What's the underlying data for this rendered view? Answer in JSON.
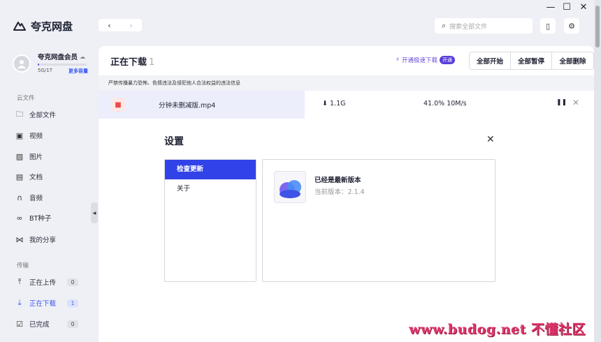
{
  "app": {
    "name": "夸克网盘",
    "window_controls": [
      "minimize",
      "maximize",
      "close"
    ]
  },
  "user": {
    "name": "夸克网盘会员",
    "quota": "5G/1T",
    "quota_fraction": 0.005,
    "more_capacity": "更多容量"
  },
  "sidebar": {
    "cloud_label": "云文件",
    "cloud_items": [
      {
        "label": "全部文件",
        "icon": "folder-icon"
      },
      {
        "label": "视频",
        "icon": "video-icon"
      },
      {
        "label": "图片",
        "icon": "image-icon"
      },
      {
        "label": "文档",
        "icon": "document-icon"
      },
      {
        "label": "音频",
        "icon": "headphones-icon"
      },
      {
        "label": "BT种子",
        "icon": "link-icon"
      },
      {
        "label": "我的分享",
        "icon": "share-icon"
      }
    ],
    "transfer_label": "传输",
    "transfer_items": [
      {
        "label": "正在上传",
        "count": "0",
        "icon": "upload-icon"
      },
      {
        "label": "正在下载",
        "count": "1",
        "icon": "download-icon",
        "active": true
      },
      {
        "label": "已完成",
        "count": "0",
        "icon": "done-icon"
      }
    ]
  },
  "search": {
    "placeholder": "搜索全部文件"
  },
  "main": {
    "title": "正在下载",
    "title_count": "1",
    "speed_link": "开通极速下载",
    "speed_badge": "开通",
    "actions": [
      "全部开始",
      "全部暂停",
      "全部删除"
    ],
    "notice": "严禁传播暴力恐怖、色情违法及侵犯他人合法权益的违法信息",
    "downloads": [
      {
        "name": "分钟未删减版.mp4",
        "size": "1.1G",
        "progress": "41.0% 10M/s"
      }
    ]
  },
  "settings": {
    "title": "设置",
    "menu": [
      "检查更新",
      "关于"
    ],
    "active_menu": 0,
    "update_status": "已经是最新版本",
    "current_version": "当前版本：2.1.4"
  },
  "watermark": "www.budog.net 不懂社区",
  "colors": {
    "accent": "#3142e8",
    "brand_purple": "#5a3fd8",
    "video_red": "#ef4a4a",
    "watermark": "#e0356a"
  }
}
